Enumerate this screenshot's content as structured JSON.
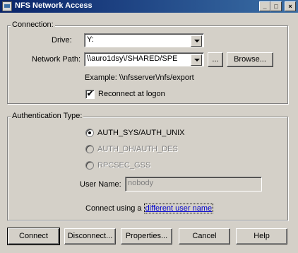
{
  "window": {
    "title": "NFS Network Access",
    "buttons": {
      "minimize": "_",
      "maximize": "□",
      "close": "×"
    }
  },
  "connection": {
    "legend": "Connection:",
    "drive_label": "Drive:",
    "drive_value": "Y:",
    "path_label": "Network Path:",
    "path_value": "\\\\auro1dsy\\/SHARED/SPE",
    "ellipsis_label": "...",
    "browse_label": "Browse...",
    "example_text": "Example:  \\\\nfsserver\\/nfs/export",
    "reconnect_label": "Reconnect at logon",
    "reconnect_checked": true
  },
  "auth": {
    "legend": "Authentication Type:",
    "options": [
      {
        "label": "AUTH_SYS/AUTH_UNIX",
        "selected": true,
        "enabled": true
      },
      {
        "label": "AUTH_DH/AUTH_DES",
        "selected": false,
        "enabled": false
      },
      {
        "label": "RPCSEC_GSS",
        "selected": false,
        "enabled": false
      }
    ],
    "username_label": "User Name:",
    "username_value": "nobody",
    "connect_using_prefix": "Connect using a ",
    "connect_using_link": "different user name"
  },
  "footer": {
    "connect": "Connect",
    "disconnect": "Disconnect...",
    "properties": "Properties...",
    "cancel": "Cancel",
    "help": "Help"
  }
}
